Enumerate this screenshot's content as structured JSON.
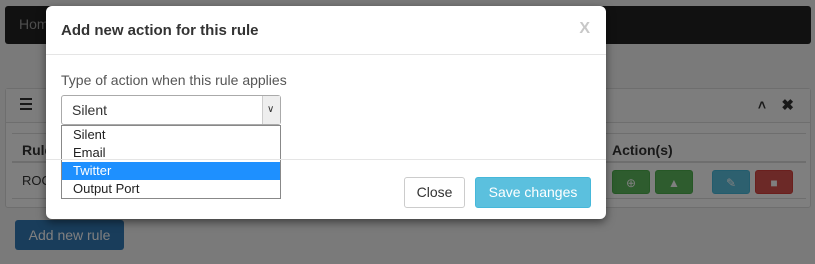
{
  "nav": {
    "home_label": "Home"
  },
  "panel": {
    "table_headers": {
      "rule": "Rule",
      "actions": "Action(s)"
    },
    "row": {
      "rule": "ROOT"
    }
  },
  "add_rule_label": "Add new rule",
  "modal": {
    "title": "Add new action for this rule",
    "close_glyph": "X",
    "field_label": "Type of action when this rule applies",
    "selected_value": "Silent",
    "options": [
      "Silent",
      "Email",
      "Twitter",
      "Output Port"
    ],
    "highlighted_option": "Twitter",
    "close_label": "Close",
    "save_label": "Save changes"
  },
  "icons": {
    "menu": "menu-icon",
    "collapse": "chevron-up-icon",
    "panel_close": "close-icon",
    "zoom": "search-plus-icon",
    "bell": "bell-icon",
    "edit": "edit-icon",
    "delete": "trash-icon",
    "caret": "chevron-down-icon"
  },
  "colors": {
    "save": "#5bc0de",
    "primary": "#337ab7",
    "success": "#5cb85c",
    "danger": "#d9534f",
    "highlight": "#1e90ff"
  }
}
